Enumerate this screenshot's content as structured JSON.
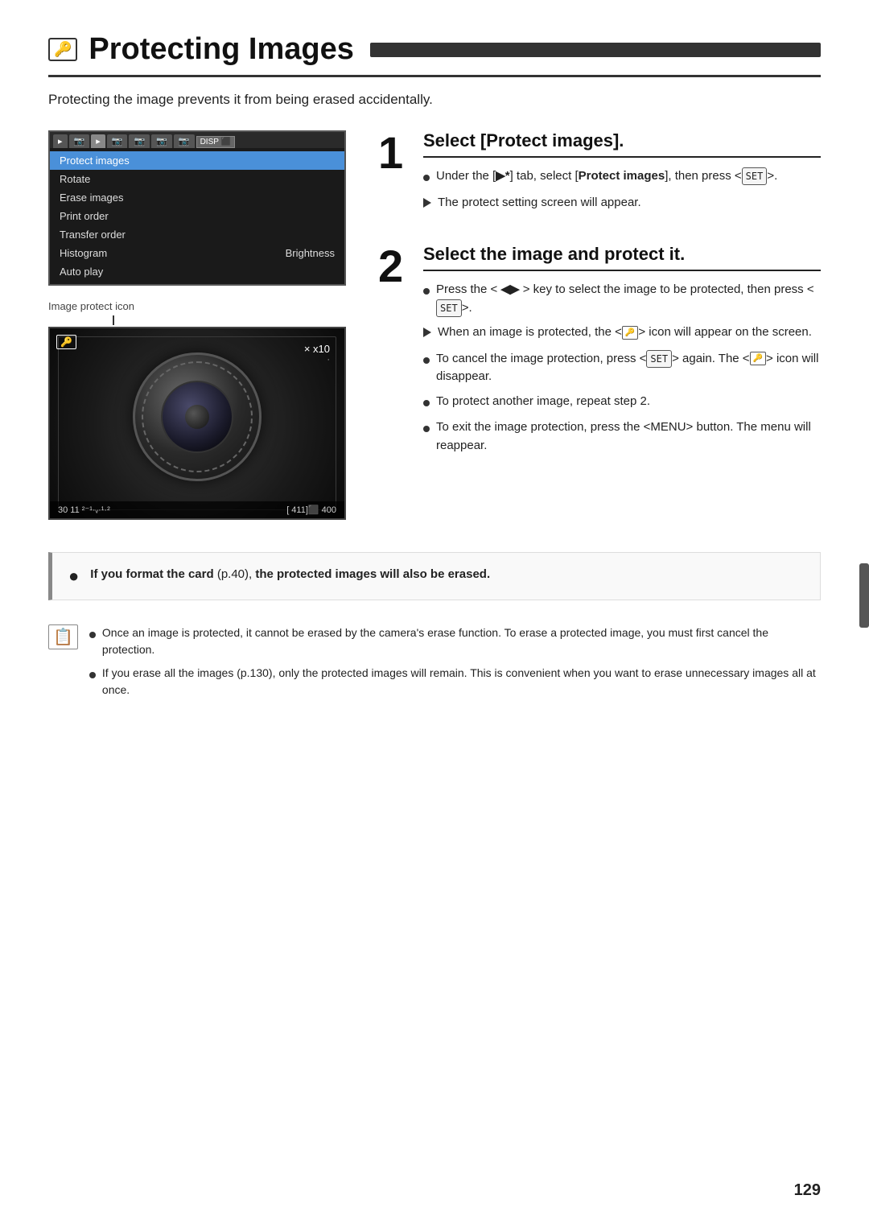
{
  "page": {
    "title": "Protecting Images",
    "title_icon": "🔑",
    "subtitle": "Protecting the image prevents it from being erased accidentally.",
    "page_number": "129"
  },
  "menu": {
    "tabs": [
      "▶",
      "📷",
      "▶",
      "📷",
      "📷",
      "📷",
      "📷"
    ],
    "active_tab": "▶",
    "disp_label": "DISP ⬛",
    "items": [
      {
        "label": "Protect images",
        "selected": true
      },
      {
        "label": "Rotate"
      },
      {
        "label": "Erase images"
      },
      {
        "label": "Print order"
      },
      {
        "label": "Transfer order"
      },
      {
        "label": "Histogram",
        "right": "Brightness"
      },
      {
        "label": "Auto play"
      }
    ]
  },
  "image_protect_label": "Image protect icon",
  "camera_image": {
    "zoom": "× x10",
    "bottom_left": "30  11  ²⁻¹⁻ᵥ·ᵥᵥ",
    "bottom_right": "[ 411]⬛ 400"
  },
  "steps": [
    {
      "number": "1",
      "title": "Select [Protect images].",
      "bullets": [
        {
          "type": "circle",
          "text": "Under the [▶*] tab, select [Protect images], then press <(SET)>."
        },
        {
          "type": "triangle",
          "text": "The protect setting screen will appear."
        }
      ]
    },
    {
      "number": "2",
      "title": "Select the image and protect it.",
      "bullets": [
        {
          "type": "circle",
          "text": "Press the < ◀▶ > key to select the image to be protected, then press <(SET)>."
        },
        {
          "type": "triangle",
          "text": "When an image is protected, the <🔑> icon will appear on the screen."
        },
        {
          "type": "circle",
          "text": "To cancel the image protection, press <(SET)> again. The <🔑> icon will disappear."
        },
        {
          "type": "circle",
          "text": "To protect another image, repeat step 2."
        },
        {
          "type": "circle",
          "text": "To exit the image protection, press the <MENU> button. The menu will reappear."
        }
      ]
    }
  ],
  "warning": {
    "icon": "●",
    "text": "If you format the card (p.40), the protected images will also be erased."
  },
  "notes": {
    "icon": "📋",
    "items": [
      "Once an image is protected, it cannot be erased by the camera's erase function. To erase a protected image, you must first cancel the protection.",
      "If you erase all the images (p.130), only the protected images will remain. This is convenient when you want to erase unnecessary images all at once."
    ]
  }
}
